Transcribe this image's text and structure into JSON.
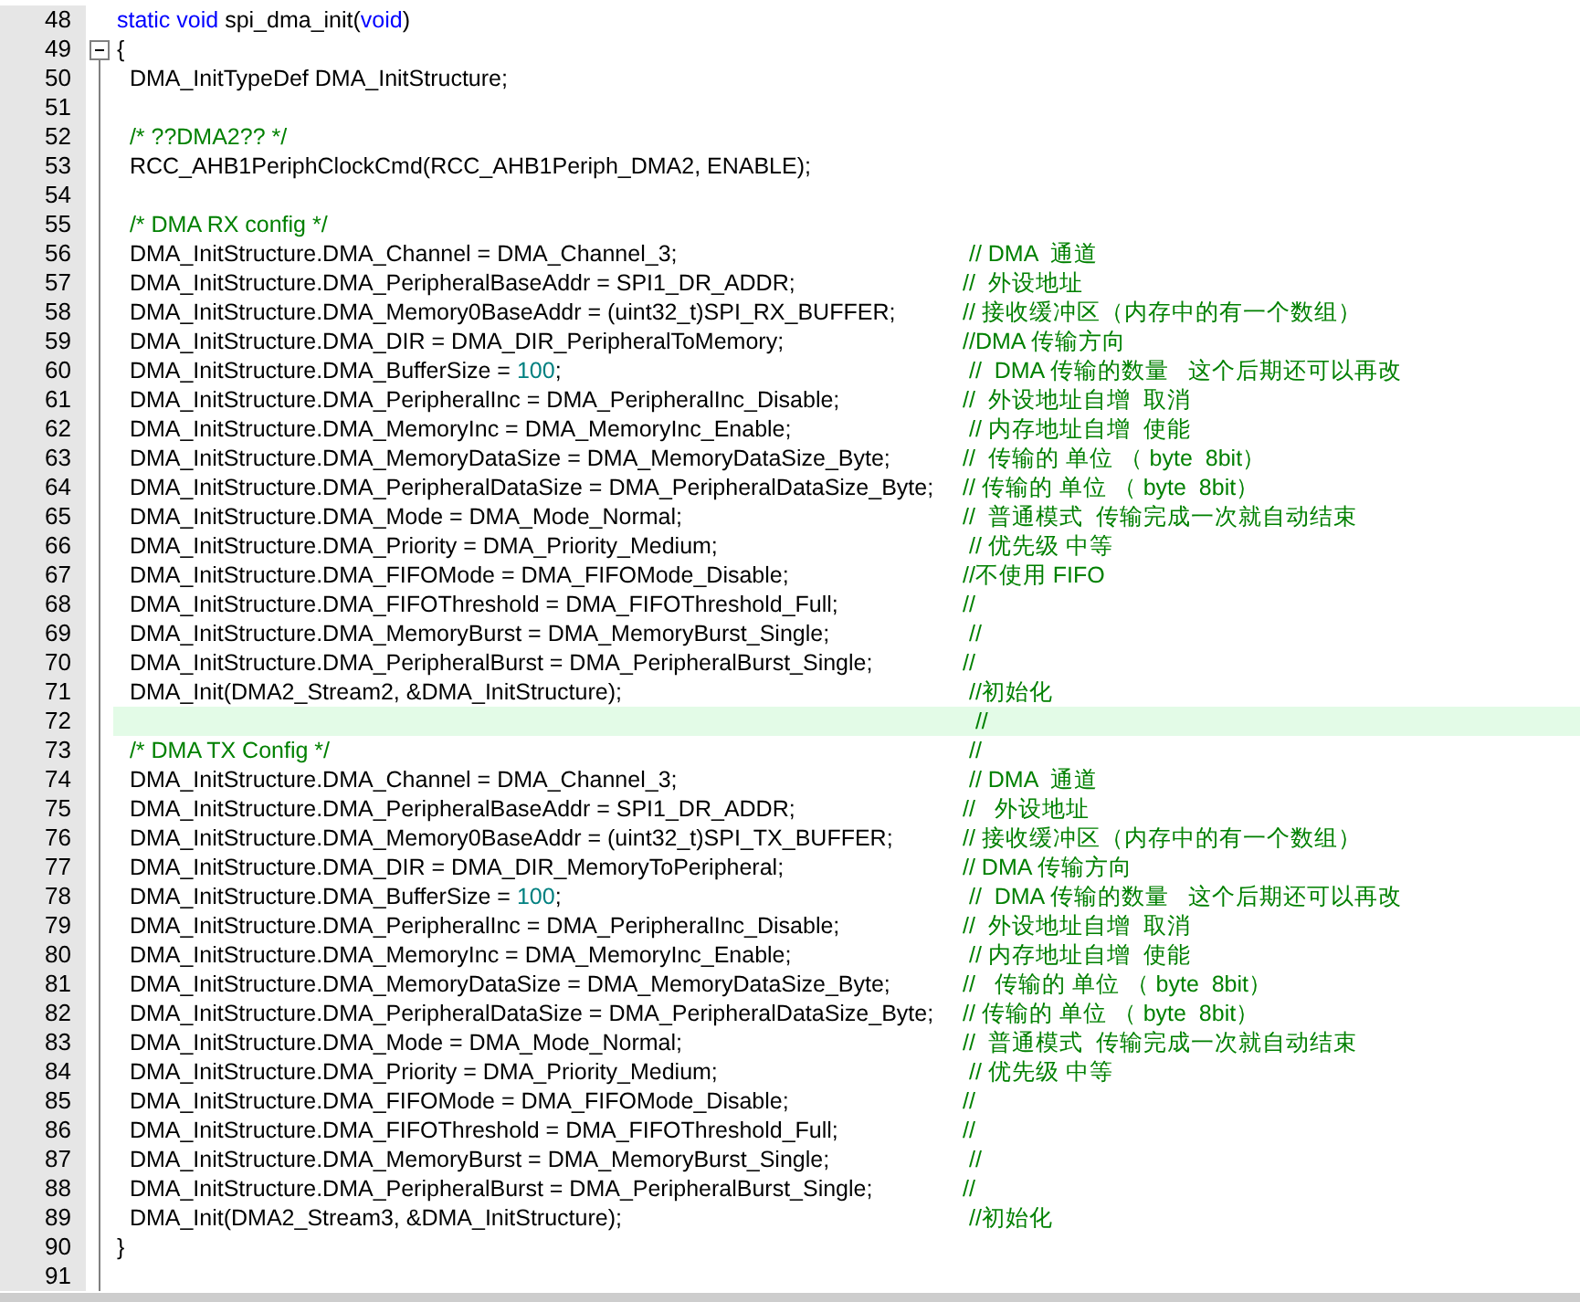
{
  "editor": {
    "lines": [
      {
        "number": "48",
        "kind": "plain",
        "current": false,
        "tokens": [
          {
            "kind": "keyword",
            "text": "static void"
          },
          {
            "kind": "plain",
            "text": " spi_dma_init("
          },
          {
            "kind": "keyword",
            "text": "void"
          },
          {
            "kind": "plain",
            "text": ")"
          }
        ]
      },
      {
        "number": "49",
        "kind": "foldstart",
        "current": false,
        "tokens": [
          {
            "kind": "plain",
            "text": "{"
          }
        ]
      },
      {
        "number": "50",
        "kind": "foldbody",
        "current": false,
        "tokens": [
          {
            "kind": "plain",
            "text": "  DMA_InitTypeDef DMA_InitStructure;"
          }
        ]
      },
      {
        "number": "51",
        "kind": "foldbody",
        "current": false
      },
      {
        "number": "52",
        "kind": "foldbody",
        "current": false,
        "tokens": [
          {
            "kind": "comment",
            "text": "  /* ??DMA2?? */"
          }
        ]
      },
      {
        "number": "53",
        "kind": "foldbody",
        "current": false,
        "tokens": [
          {
            "kind": "plain",
            "text": "  RCC_AHB1PeriphClockCmd(RCC_AHB1Periph_DMA2, ENABLE);"
          }
        ]
      },
      {
        "number": "54",
        "kind": "foldbody",
        "current": false
      },
      {
        "number": "55",
        "kind": "foldbody",
        "current": false,
        "tokens": [
          {
            "kind": "comment",
            "text": "  /* DMA RX config */"
          }
        ]
      },
      {
        "number": "56",
        "kind": "foldbody",
        "current": false,
        "tokens": [
          {
            "kind": "plain",
            "text": "  DMA_InitStructure.DMA_Channel = DMA_Channel_3;"
          }
        ],
        "comment": " // DMA  通道"
      },
      {
        "number": "57",
        "kind": "foldbody",
        "current": false,
        "tokens": [
          {
            "kind": "plain",
            "text": "  DMA_InitStructure.DMA_PeripheralBaseAddr = SPI1_DR_ADDR;"
          }
        ],
        "comment": "//  外设地址"
      },
      {
        "number": "58",
        "kind": "foldbody",
        "current": false,
        "tokens": [
          {
            "kind": "plain",
            "text": "  DMA_InitStructure.DMA_Memory0BaseAddr = (uint32_t)SPI_RX_BUFFER;"
          }
        ],
        "comment": "// 接收缓冲区（内存中的有一个数组）"
      },
      {
        "number": "59",
        "kind": "foldbody",
        "current": false,
        "tokens": [
          {
            "kind": "plain",
            "text": "  DMA_InitStructure.DMA_DIR = DMA_DIR_PeripheralToMemory;"
          }
        ],
        "comment": "//DMA 传输方向"
      },
      {
        "number": "60",
        "kind": "foldbody",
        "current": false,
        "tokens": [
          {
            "kind": "plain",
            "text": "  DMA_InitStructure.DMA_BufferSize = "
          },
          {
            "kind": "number",
            "text": "100"
          },
          {
            "kind": "plain",
            "text": ";"
          }
        ],
        "comment": " //  DMA 传输的数量   这个后期还可以再改"
      },
      {
        "number": "61",
        "kind": "foldbody",
        "current": false,
        "tokens": [
          {
            "kind": "plain",
            "text": "  DMA_InitStructure.DMA_PeripheralInc = DMA_PeripheralInc_Disable;"
          }
        ],
        "comment": "//  外设地址自增  取消"
      },
      {
        "number": "62",
        "kind": "foldbody",
        "current": false,
        "tokens": [
          {
            "kind": "plain",
            "text": "  DMA_InitStructure.DMA_MemoryInc = DMA_MemoryInc_Enable;"
          }
        ],
        "comment": " // 内存地址自增  使能"
      },
      {
        "number": "63",
        "kind": "foldbody",
        "current": false,
        "tokens": [
          {
            "kind": "plain",
            "text": "  DMA_InitStructure.DMA_MemoryDataSize = DMA_MemoryDataSize_Byte;"
          }
        ],
        "comment": "//  传输的 单位 （ byte  8bit）"
      },
      {
        "number": "64",
        "kind": "foldbody",
        "current": false,
        "tokens": [
          {
            "kind": "plain",
            "text": "  DMA_InitStructure.DMA_PeripheralDataSize = DMA_PeripheralDataSize_Byte;"
          }
        ],
        "comment": "// 传输的 单位 （ byte  8bit）"
      },
      {
        "number": "65",
        "kind": "foldbody",
        "current": false,
        "tokens": [
          {
            "kind": "plain",
            "text": "  DMA_InitStructure.DMA_Mode = DMA_Mode_Normal;"
          }
        ],
        "comment": "//  普通模式  传输完成一次就自动结束"
      },
      {
        "number": "66",
        "kind": "foldbody",
        "current": false,
        "tokens": [
          {
            "kind": "plain",
            "text": "  DMA_InitStructure.DMA_Priority = DMA_Priority_Medium;"
          }
        ],
        "comment": " // 优先级 中等"
      },
      {
        "number": "67",
        "kind": "foldbody",
        "current": false,
        "tokens": [
          {
            "kind": "plain",
            "text": "  DMA_InitStructure.DMA_FIFOMode = DMA_FIFOMode_Disable;"
          }
        ],
        "comment": "//不使用 FIFO"
      },
      {
        "number": "68",
        "kind": "foldbody",
        "current": false,
        "tokens": [
          {
            "kind": "plain",
            "text": "  DMA_InitStructure.DMA_FIFOThreshold = DMA_FIFOThreshold_Full;"
          }
        ],
        "comment": "//"
      },
      {
        "number": "69",
        "kind": "foldbody",
        "current": false,
        "tokens": [
          {
            "kind": "plain",
            "text": "  DMA_InitStructure.DMA_MemoryBurst = DMA_MemoryBurst_Single;"
          }
        ],
        "comment": " //"
      },
      {
        "number": "70",
        "kind": "foldbody",
        "current": false,
        "tokens": [
          {
            "kind": "plain",
            "text": "  DMA_InitStructure.DMA_PeripheralBurst = DMA_PeripheralBurst_Single;"
          }
        ],
        "comment": "//"
      },
      {
        "number": "71",
        "kind": "foldbody",
        "current": false,
        "tokens": [
          {
            "kind": "plain",
            "text": "  DMA_Init(DMA2_Stream2, &DMA_InitStructure);"
          }
        ],
        "comment": " //初始化"
      },
      {
        "number": "72",
        "kind": "foldbody",
        "current": true,
        "comment": "  //"
      },
      {
        "number": "73",
        "kind": "foldbody",
        "current": false,
        "tokens": [
          {
            "kind": "comment",
            "text": "  /* DMA TX Config */"
          }
        ],
        "comment": " //"
      },
      {
        "number": "74",
        "kind": "foldbody",
        "current": false,
        "tokens": [
          {
            "kind": "plain",
            "text": "  DMA_InitStructure.DMA_Channel = DMA_Channel_3;"
          }
        ],
        "comment": " // DMA  通道"
      },
      {
        "number": "75",
        "kind": "foldbody",
        "current": false,
        "tokens": [
          {
            "kind": "plain",
            "text": "  DMA_InitStructure.DMA_PeripheralBaseAddr = SPI1_DR_ADDR;"
          }
        ],
        "comment": "//   外设地址"
      },
      {
        "number": "76",
        "kind": "foldbody",
        "current": false,
        "tokens": [
          {
            "kind": "plain",
            "text": "  DMA_InitStructure.DMA_Memory0BaseAddr = (uint32_t)SPI_TX_BUFFER;"
          }
        ],
        "comment": "// 接收缓冲区（内存中的有一个数组）"
      },
      {
        "number": "77",
        "kind": "foldbody",
        "current": false,
        "tokens": [
          {
            "kind": "plain",
            "text": "  DMA_InitStructure.DMA_DIR = DMA_DIR_MemoryToPeripheral;"
          }
        ],
        "comment": "// DMA 传输方向"
      },
      {
        "number": "78",
        "kind": "foldbody",
        "current": false,
        "tokens": [
          {
            "kind": "plain",
            "text": "  DMA_InitStructure.DMA_BufferSize = "
          },
          {
            "kind": "number",
            "text": "100"
          },
          {
            "kind": "plain",
            "text": ";"
          }
        ],
        "comment": " //  DMA 传输的数量   这个后期还可以再改"
      },
      {
        "number": "79",
        "kind": "foldbody",
        "current": false,
        "tokens": [
          {
            "kind": "plain",
            "text": "  DMA_InitStructure.DMA_PeripheralInc = DMA_PeripheralInc_Disable;"
          }
        ],
        "comment": "//  外设地址自增  取消"
      },
      {
        "number": "80",
        "kind": "foldbody",
        "current": false,
        "tokens": [
          {
            "kind": "plain",
            "text": "  DMA_InitStructure.DMA_MemoryInc = DMA_MemoryInc_Enable;"
          }
        ],
        "comment": " // 内存地址自增  使能"
      },
      {
        "number": "81",
        "kind": "foldbody",
        "current": false,
        "tokens": [
          {
            "kind": "plain",
            "text": "  DMA_InitStructure.DMA_MemoryDataSize = DMA_MemoryDataSize_Byte;"
          }
        ],
        "comment": "//   传输的 单位 （ byte  8bit）"
      },
      {
        "number": "82",
        "kind": "foldbody",
        "current": false,
        "tokens": [
          {
            "kind": "plain",
            "text": "  DMA_InitStructure.DMA_PeripheralDataSize = DMA_PeripheralDataSize_Byte;"
          }
        ],
        "comment": "// 传输的 单位 （ byte  8bit）"
      },
      {
        "number": "83",
        "kind": "foldbody",
        "current": false,
        "tokens": [
          {
            "kind": "plain",
            "text": "  DMA_InitStructure.DMA_Mode = DMA_Mode_Normal;"
          }
        ],
        "comment": "//  普通模式  传输完成一次就自动结束"
      },
      {
        "number": "84",
        "kind": "foldbody",
        "current": false,
        "tokens": [
          {
            "kind": "plain",
            "text": "  DMA_InitStructure.DMA_Priority = DMA_Priority_Medium;"
          }
        ],
        "comment": " // 优先级 中等"
      },
      {
        "number": "85",
        "kind": "foldbody",
        "current": false,
        "tokens": [
          {
            "kind": "plain",
            "text": "  DMA_InitStructure.DMA_FIFOMode = DMA_FIFOMode_Disable;"
          }
        ],
        "comment": "//"
      },
      {
        "number": "86",
        "kind": "foldbody",
        "current": false,
        "tokens": [
          {
            "kind": "plain",
            "text": "  DMA_InitStructure.DMA_FIFOThreshold = DMA_FIFOThreshold_Full;"
          }
        ],
        "comment": "//"
      },
      {
        "number": "87",
        "kind": "foldbody",
        "current": false,
        "tokens": [
          {
            "kind": "plain",
            "text": "  DMA_InitStructure.DMA_MemoryBurst = DMA_MemoryBurst_Single;"
          }
        ],
        "comment": " //"
      },
      {
        "number": "88",
        "kind": "foldbody",
        "current": false,
        "tokens": [
          {
            "kind": "plain",
            "text": "  DMA_InitStructure.DMA_PeripheralBurst = DMA_PeripheralBurst_Single;"
          }
        ],
        "comment": "//"
      },
      {
        "number": "89",
        "kind": "foldbody",
        "current": false,
        "tokens": [
          {
            "kind": "plain",
            "text": "  DMA_Init(DMA2_Stream3, &DMA_InitStructure);"
          }
        ],
        "comment": " //初始化"
      },
      {
        "number": "90",
        "kind": "foldbody",
        "current": false,
        "tokens": [
          {
            "kind": "plain",
            "text": "}"
          }
        ]
      },
      {
        "number": "91",
        "kind": "foldbody",
        "current": false
      }
    ]
  }
}
